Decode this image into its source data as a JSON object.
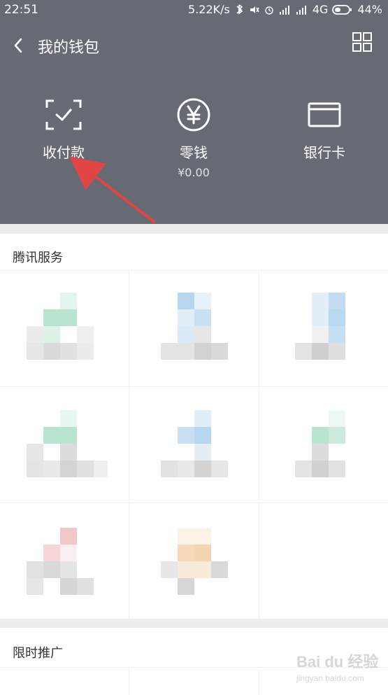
{
  "status": {
    "time": "22:51",
    "net_speed": "5.22K/s",
    "carrier": "4G",
    "battery": "44%",
    "icons": [
      "bluetooth-icon",
      "mute-icon",
      "alarm-icon",
      "signal-icon",
      "signal-icon-2",
      "battery-icon"
    ]
  },
  "header": {
    "back_icon": "back-arrow-icon",
    "title": "我的钱包",
    "grid_icon": "grid-icon",
    "features": [
      {
        "name": "collect-pay",
        "label": "收付款",
        "icon": "scan-check-icon"
      },
      {
        "name": "change",
        "label": "零钱",
        "sub": "¥0.00",
        "icon": "yen-circle-icon"
      },
      {
        "name": "bank-card",
        "label": "银行卡",
        "icon": "card-icon"
      }
    ],
    "annotation": "red-arrow"
  },
  "sections": {
    "tencent_services": "腾讯服务",
    "limited_promo": "限时推广"
  },
  "watermark": {
    "brand": "Bai du 经验",
    "site": "jingyan.baidu.com"
  },
  "colors": {
    "header_bg": "#666a73",
    "accent_green": "#b9e4cf",
    "accent_blue": "#b7d7ee",
    "accent_pink": "#f2c7c9",
    "accent_peach": "#f5d9b8"
  }
}
